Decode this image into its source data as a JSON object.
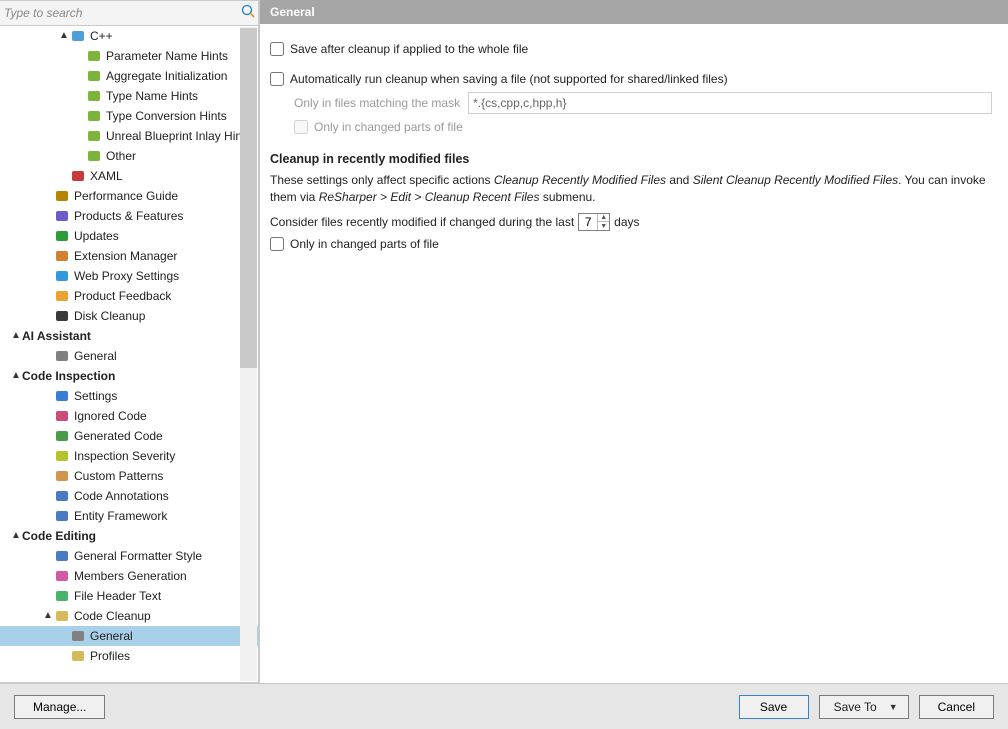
{
  "search": {
    "placeholder": "Type to search"
  },
  "tree": [
    {
      "level": 3,
      "caret": "▲",
      "iconColor": "#4fa0d8",
      "label": "C++"
    },
    {
      "level": 4,
      "iconColor": "#7db43c",
      "label": "Parameter Name Hints"
    },
    {
      "level": 4,
      "iconColor": "#7db43c",
      "label": "Aggregate Initialization"
    },
    {
      "level": 4,
      "iconColor": "#7db43c",
      "label": "Type Name Hints"
    },
    {
      "level": 4,
      "iconColor": "#7db43c",
      "label": "Type Conversion Hints"
    },
    {
      "level": 4,
      "iconColor": "#7db43c",
      "label": "Unreal Blueprint Inlay Hints"
    },
    {
      "level": 4,
      "iconColor": "#7db43c",
      "label": "Other"
    },
    {
      "level": 3,
      "iconColor": "#c93b3b",
      "label": "XAML"
    },
    {
      "level": 2,
      "iconColor": "#b58500",
      "label": "Performance Guide"
    },
    {
      "level": 2,
      "iconColor": "#6b5ec6",
      "label": "Products & Features"
    },
    {
      "level": 2,
      "iconColor": "#2e9a3a",
      "label": "Updates"
    },
    {
      "level": 2,
      "iconColor": "#d08030",
      "label": "Extension Manager"
    },
    {
      "level": 2,
      "iconColor": "#3598db",
      "label": "Web Proxy Settings"
    },
    {
      "level": 2,
      "iconColor": "#e9a233",
      "label": "Product Feedback"
    },
    {
      "level": 2,
      "iconColor": "#3b3b3b",
      "label": "Disk Cleanup"
    },
    {
      "level": 0,
      "caret": "▲",
      "bold": true,
      "label": "AI Assistant"
    },
    {
      "level": 2,
      "iconColor": "#808080",
      "label": "General"
    },
    {
      "level": 0,
      "caret": "▲",
      "bold": true,
      "label": "Code Inspection"
    },
    {
      "level": 2,
      "iconColor": "#3a7dd6",
      "label": "Settings"
    },
    {
      "level": 2,
      "iconColor": "#c94d7a",
      "label": "Ignored Code"
    },
    {
      "level": 2,
      "iconColor": "#4a9c4a",
      "label": "Generated Code"
    },
    {
      "level": 2,
      "iconColor": "#b3c32e",
      "label": "Inspection Severity"
    },
    {
      "level": 2,
      "iconColor": "#cf9550",
      "label": "Custom Patterns"
    },
    {
      "level": 2,
      "iconColor": "#4a7abf",
      "label": "Code Annotations"
    },
    {
      "level": 2,
      "iconColor": "#4a7abf",
      "label": "Entity Framework"
    },
    {
      "level": 0,
      "caret": "▲",
      "bold": true,
      "label": "Code Editing"
    },
    {
      "level": 2,
      "iconColor": "#4a7abf",
      "label": "General Formatter Style"
    },
    {
      "level": 2,
      "iconColor": "#cf5aa6",
      "label": "Members Generation"
    },
    {
      "level": 2,
      "iconColor": "#4ab36a",
      "label": "File Header Text"
    },
    {
      "level": 2,
      "caret": "▲",
      "iconColor": "#d6b95a",
      "label": "Code Cleanup"
    },
    {
      "level": 3,
      "iconColor": "#808080",
      "label": "General",
      "selected": true
    },
    {
      "level": 3,
      "iconColor": "#d6b95a",
      "label": "Profiles"
    }
  ],
  "panel": {
    "header": "General",
    "save_after": "Save after cleanup if applied to the whole file",
    "auto_run": "Automatically run cleanup when saving a file (not supported for shared/linked files)",
    "mask_label": "Only in files matching the mask",
    "mask_value": "*.{cs,cpp,c,hpp,h}",
    "only_changed": "Only in changed parts of file",
    "recent_h": "Cleanup in recently modified files",
    "recent_d1": "These settings only affect specific actions ",
    "recent_d2": "Cleanup Recently Modified Files",
    "recent_d3": " and ",
    "recent_d4": "Silent Cleanup Recently Modified Files",
    "recent_d5": ". You can invoke them via ",
    "recent_d6": "ReSharper > Edit > Cleanup Recent Files",
    "recent_d7": " submenu.",
    "consider_pre": "Consider files recently modified if changed during the last ",
    "days_value": "7",
    "consider_post": " days",
    "only_changed2": "Only in changed parts of file"
  },
  "bottom": {
    "manage": "Manage...",
    "save": "Save",
    "save_to": "Save To",
    "cancel": "Cancel"
  }
}
